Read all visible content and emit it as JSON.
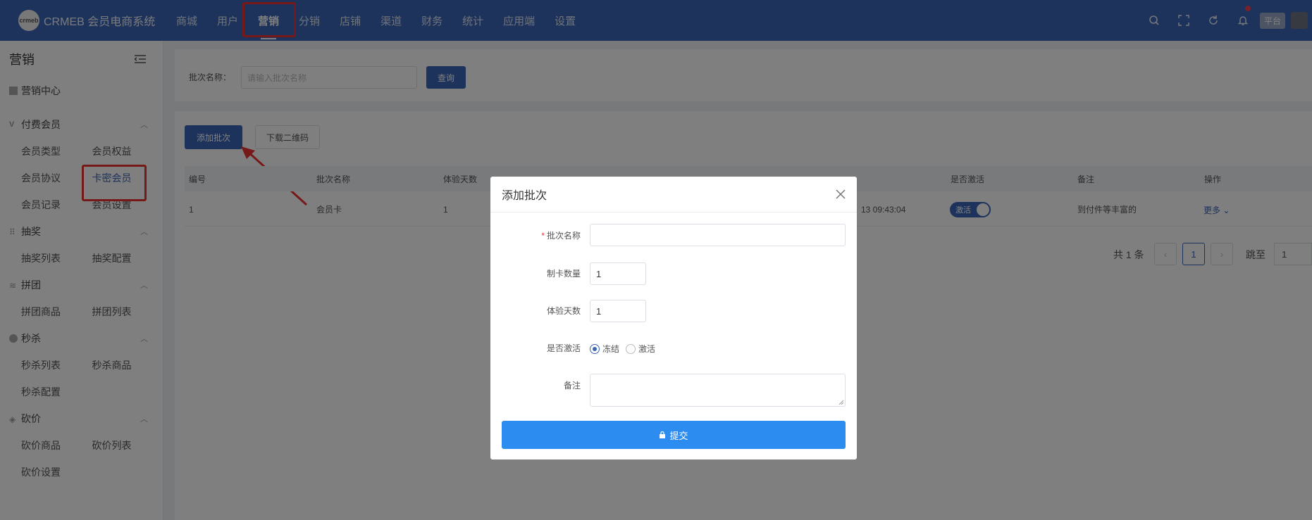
{
  "header": {
    "logo_mark": "crmeb",
    "logo_text": "CRMEB 会员电商系统",
    "nav": [
      "商城",
      "用户",
      "营销",
      "分销",
      "店铺",
      "渠道",
      "财务",
      "统计",
      "应用端",
      "设置"
    ],
    "active_nav": "营销",
    "platform_label": "平台"
  },
  "sidebar": {
    "title": "营销",
    "center_label": "营销中心",
    "groups": [
      {
        "label": "付费会员",
        "items": [
          [
            "会员类型",
            "会员权益"
          ],
          [
            "会员协议",
            "卡密会员"
          ],
          [
            "会员记录",
            "会员设置"
          ]
        ]
      },
      {
        "label": "抽奖",
        "items": [
          [
            "抽奖列表",
            "抽奖配置"
          ]
        ]
      },
      {
        "label": "拼团",
        "items": [
          [
            "拼团商品",
            "拼团列表"
          ]
        ]
      },
      {
        "label": "秒杀",
        "items": [
          [
            "秒杀列表",
            "秒杀商品"
          ],
          [
            "秒杀配置",
            ""
          ]
        ]
      },
      {
        "label": "砍价",
        "items": [
          [
            "砍价商品",
            "砍价列表"
          ],
          [
            "砍价设置",
            ""
          ]
        ]
      }
    ],
    "selected_item": "卡密会员"
  },
  "filter": {
    "label": "批次名称：",
    "placeholder": "请输入批次名称",
    "query_button": "查询"
  },
  "toolbar": {
    "add_button": "添加批次",
    "download_button": "下载二维码"
  },
  "table": {
    "columns": [
      "编号",
      "批次名称",
      "体验天数",
      "",
      "",
      "",
      "是否激活",
      "备注",
      "操作"
    ],
    "rows": [
      {
        "id": "1",
        "name": "会员卡",
        "days": "1",
        "time_fragment": "13 09:43:04",
        "active": "激活",
        "remark": "到付件等丰富的",
        "action": "更多"
      }
    ]
  },
  "pagination": {
    "total": "共 1 条",
    "current": "1",
    "goto_label": "跳至",
    "goto_value": "1"
  },
  "modal": {
    "title": "添加批次",
    "fields": {
      "name_label": "批次名称",
      "count_label": "制卡数量",
      "count_value": "1",
      "days_label": "体验天数",
      "days_value": "1",
      "active_label": "是否激活",
      "radio_freeze": "冻结",
      "radio_activate": "激活",
      "selected_radio": "冻结",
      "remark_label": "备注"
    },
    "submit_label": "提交"
  },
  "colors": {
    "brand": "#3c66b6",
    "submit": "#2d8cf0",
    "highlight": "#e33333"
  }
}
